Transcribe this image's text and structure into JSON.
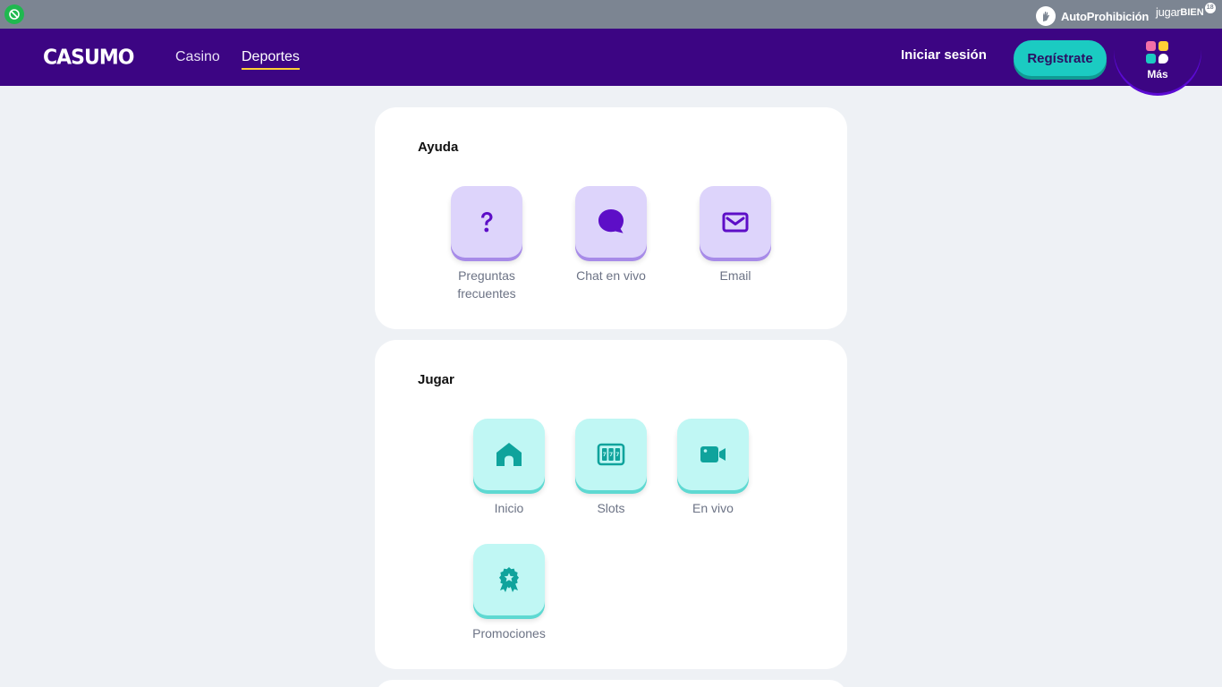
{
  "topbar": {
    "age_icon": "no-underage-icon",
    "autoprohibicion_label": "AutoProhibición",
    "jugarbien_light": "jugar",
    "jugarbien_bold": "BIEN",
    "jugarbien_age": "18"
  },
  "header": {
    "logo_text": "CASUMO",
    "nav": {
      "casino": "Casino",
      "deportes": "Deportes"
    },
    "login_label": "Iniciar sesión",
    "register_label": "Regístrate",
    "more_label": "Más",
    "colors": {
      "header_bg": "#3c0583",
      "accent": "#1bcbc2",
      "underline": "#ffcf36"
    }
  },
  "ayuda": {
    "title": "Ayuda",
    "items": [
      {
        "label": "Preguntas frecuentes",
        "icon": "question-icon"
      },
      {
        "label": "Chat en vivo",
        "icon": "chat-bubble-icon"
      },
      {
        "label": "Email",
        "icon": "envelope-icon"
      }
    ]
  },
  "jugar": {
    "title": "Jugar",
    "items": [
      {
        "label": "Inicio",
        "icon": "home-icon"
      },
      {
        "label": "Slots",
        "icon": "slot-machine-icon"
      },
      {
        "label": "En vivo",
        "icon": "video-camera-icon"
      },
      {
        "label": "Promociones",
        "icon": "award-badge-icon"
      }
    ]
  }
}
